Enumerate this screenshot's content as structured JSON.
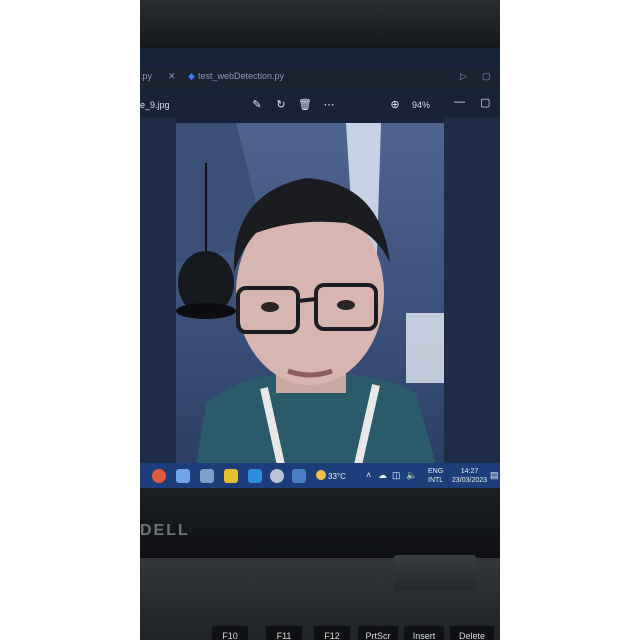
{
  "ide": {
    "tab_file": ".py",
    "tab_second": "test_webDetection.py"
  },
  "viewer": {
    "filename": "e_9.jpg",
    "zoom": "94%"
  },
  "taskbar": {
    "temperature": "33°C",
    "language_line1": "ENG",
    "language_line2": "INTL",
    "time": "14:27",
    "date": "23/03/2023"
  },
  "brand": "DELL",
  "keys": [
    "F10",
    "F11",
    "F12",
    "PrtScr",
    "Insert",
    "Delete"
  ],
  "colors": {
    "taskbar": "#1d3e7a",
    "screen": "#16233a",
    "photo_tint": "#4f6590"
  }
}
